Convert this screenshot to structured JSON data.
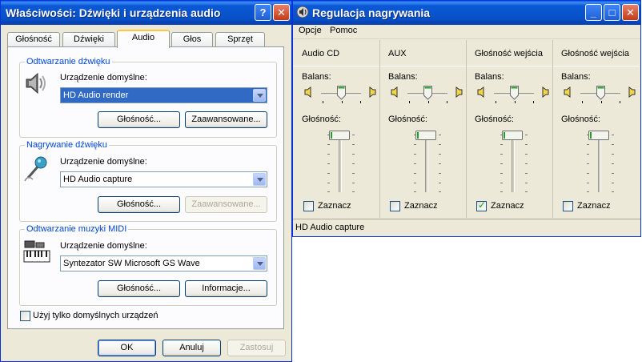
{
  "props_window": {
    "title": "Właściwości: Dźwięki i urządzenia audio",
    "help_btn": "?",
    "close_btn": "✕",
    "tabs": [
      {
        "label": "Głośność"
      },
      {
        "label": "Dźwięki"
      },
      {
        "label": "Audio",
        "active": true
      },
      {
        "label": "Głos"
      },
      {
        "label": "Sprzęt"
      }
    ],
    "playback": {
      "group_title": "Odtwarzanie dźwięku",
      "default_label": "Urządzenie domyślne:",
      "device": "HD Audio render",
      "volume_btn": "Głośność...",
      "advanced_btn": "Zaawansowane..."
    },
    "recording": {
      "group_title": "Nagrywanie dźwięku",
      "default_label": "Urządzenie domyślne:",
      "device": "HD Audio capture",
      "volume_btn": "Głośność...",
      "advanced_btn": "Zaawansowane..."
    },
    "midi": {
      "group_title": "Odtwarzanie muzyki MIDI",
      "default_label": "Urządzenie domyślne:",
      "device": "Syntezator SW Microsoft GS Wave",
      "volume_btn": "Głośność...",
      "info_btn": "Informacje..."
    },
    "only_default_label": "Użyj tylko domyślnych urządzeń",
    "ok_btn": "OK",
    "cancel_btn": "Anuluj",
    "apply_btn": "Zastosuj"
  },
  "mixer_window": {
    "title": "Regulacja nagrywania",
    "minimize_btn": "_",
    "maximize_btn": "□",
    "close_btn": "✕",
    "menu": [
      "Opcje",
      "Pomoc"
    ],
    "balance_label": "Balans:",
    "volume_label": "Głośność:",
    "select_label": "Zaznacz",
    "channels": [
      {
        "name": "Audio CD",
        "selected": false,
        "balance": 0.5,
        "volume": 1.0
      },
      {
        "name": "AUX",
        "selected": false,
        "balance": 0.5,
        "volume": 1.0
      },
      {
        "name": "Głośność wejścia",
        "selected": true,
        "balance": 0.5,
        "volume": 1.0
      },
      {
        "name": "Głośność wejścia",
        "selected": false,
        "balance": 0.5,
        "volume": 1.0
      }
    ],
    "status": "HD Audio capture"
  },
  "colors": {
    "titlebar": "#0a58d6",
    "window_bg": "#ece9d8",
    "group_title": "#0046d5",
    "selection": "#316ac5"
  }
}
